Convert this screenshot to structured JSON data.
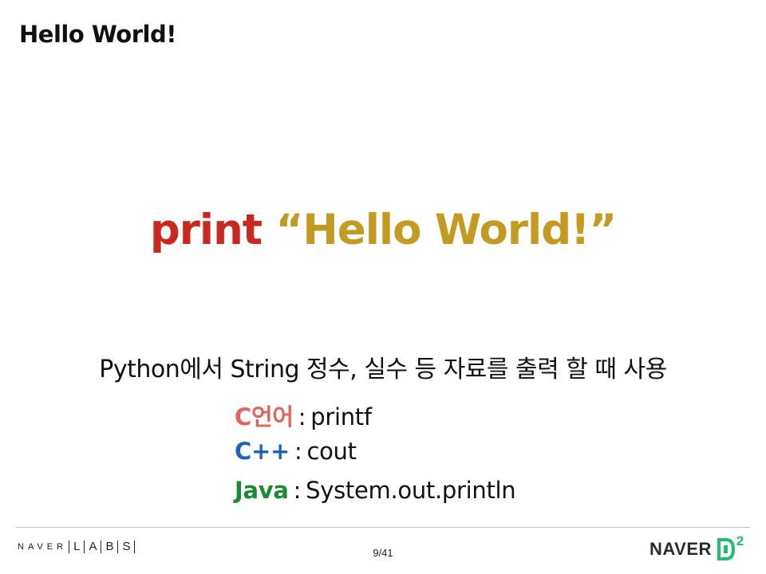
{
  "slide": {
    "title": "Hello World!",
    "code": {
      "keyword": "print",
      "string": "“Hello World!”"
    },
    "description": "Python에서 String 정수, 실수 등 자료를 출력 할 때 사용",
    "equivalents": [
      {
        "lang": "C언어",
        "sep": ":",
        "func": "printf",
        "color": "#e06460"
      },
      {
        "lang": "C++",
        "sep": ":",
        "func": "cout",
        "color": "#1f63b6"
      },
      {
        "lang": "Java",
        "sep": ":",
        "func": "System.out.println",
        "color": "#1e8a33"
      }
    ]
  },
  "footer": {
    "left_logo": {
      "naver": "NAVER",
      "letters": [
        "L",
        "A",
        "B",
        "S"
      ]
    },
    "page_number": "9/41",
    "right_logo": {
      "naver": "NAVER",
      "d2_sup": "2",
      "accent": "#1fbf6e"
    }
  },
  "colors": {
    "print_keyword": "#c8281e",
    "string_literal": "#c39a22"
  }
}
